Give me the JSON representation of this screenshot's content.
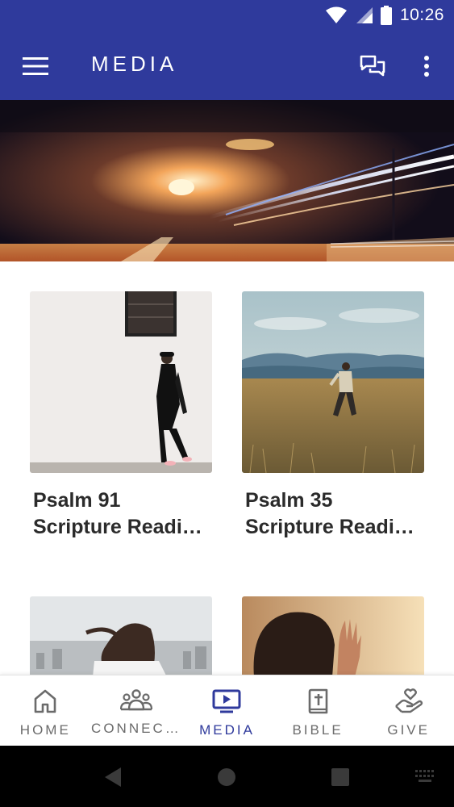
{
  "status_bar": {
    "time": "10:26",
    "icons": [
      "wifi-icon",
      "signal-icon",
      "battery-icon"
    ]
  },
  "app_bar": {
    "title": "MEDIA",
    "menu_icon": "hamburger-icon",
    "chat_icon": "chat-icon",
    "more_icon": "more-vert-icon"
  },
  "colors": {
    "primary": "#2f3a9c",
    "nav_inactive": "#6b6b6b",
    "nav_active": "#2f3a9c"
  },
  "cards": [
    {
      "title_line1": "Psalm 91",
      "title_line2": "Scripture Readi…"
    },
    {
      "title_line1": "Psalm 35",
      "title_line2": "Scripture Readi…"
    },
    {
      "title_line1": "",
      "title_line2": ""
    },
    {
      "title_line1": "",
      "title_line2": ""
    }
  ],
  "bottom_nav": {
    "items": [
      {
        "label": "HOME",
        "icon": "home-icon"
      },
      {
        "label": "CONNEC…",
        "icon": "people-icon"
      },
      {
        "label": "MEDIA",
        "icon": "tv-play-icon",
        "active": true
      },
      {
        "label": "BIBLE",
        "icon": "bible-icon"
      },
      {
        "label": "GIVE",
        "icon": "hand-heart-icon"
      }
    ]
  },
  "system_nav": {
    "icons": [
      "back-icon",
      "home-circle-icon",
      "recents-icon",
      "keyboard-icon"
    ]
  }
}
